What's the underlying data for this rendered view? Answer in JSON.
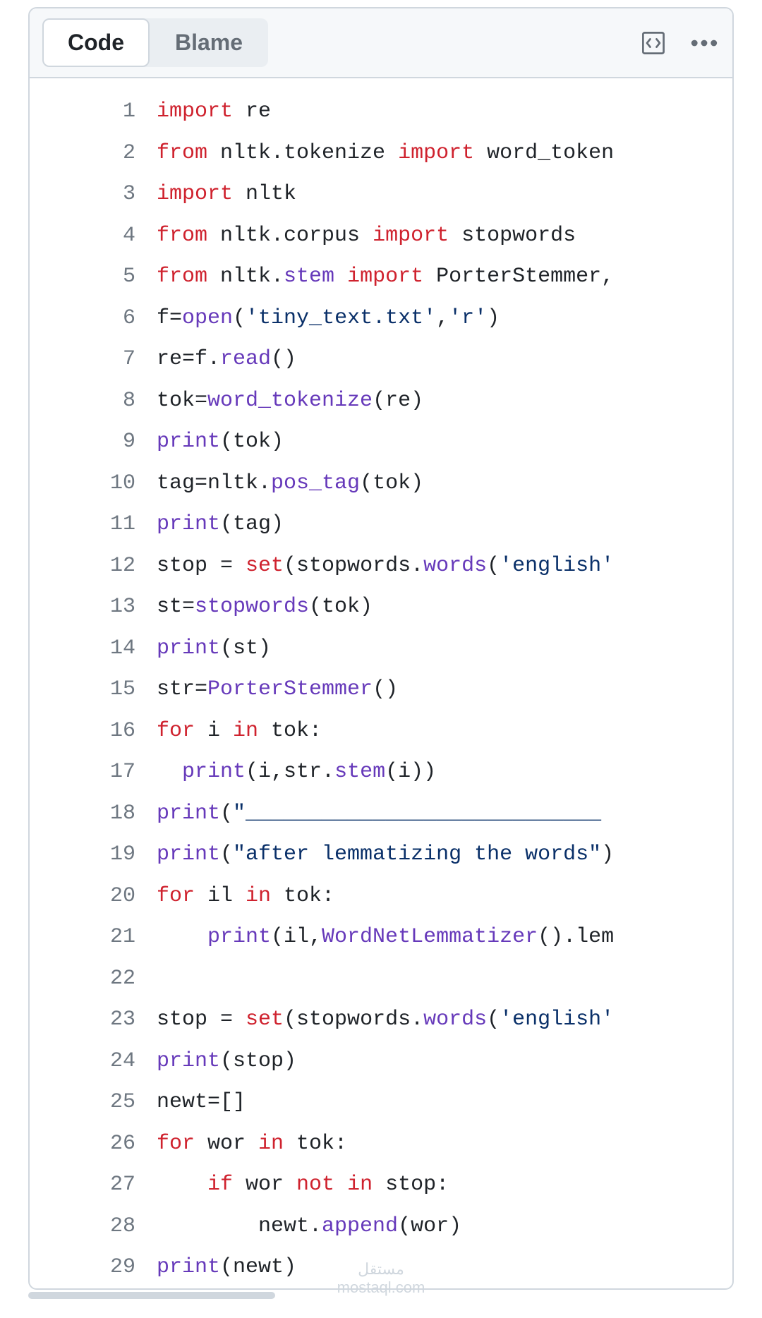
{
  "toolbar": {
    "code_tab": "Code",
    "blame_tab": "Blame"
  },
  "code": {
    "lines": [
      "import re",
      "from nltk.tokenize import word_token",
      "import nltk",
      "from nltk.corpus import stopwords",
      "from nltk.stem import PorterStemmer,",
      "f=open('tiny_text.txt','r')",
      "re=f.read()",
      "tok=word_tokenize(re)",
      "print(tok)",
      "tag=nltk.pos_tag(tok)",
      "print(tag)",
      "stop = set(stopwords.words('english'",
      "st=stopwords(tok)",
      "print(st)",
      "str=PorterStemmer()",
      "for i in tok:",
      "  print(i,str.stem(i))",
      "print(\"____________________________",
      "print(\"after lemmatizing the words\")",
      "for il in tok:",
      "    print(il,WordNetLemmatizer().lem",
      "",
      "stop = set(stopwords.words('english'",
      "print(stop)",
      "newt=[]",
      "for wor in tok:",
      "    if wor not in stop:",
      "        newt.append(wor)",
      "print(newt)"
    ]
  },
  "watermark": {
    "top": "مستقل",
    "bottom": "mostaql.com"
  }
}
